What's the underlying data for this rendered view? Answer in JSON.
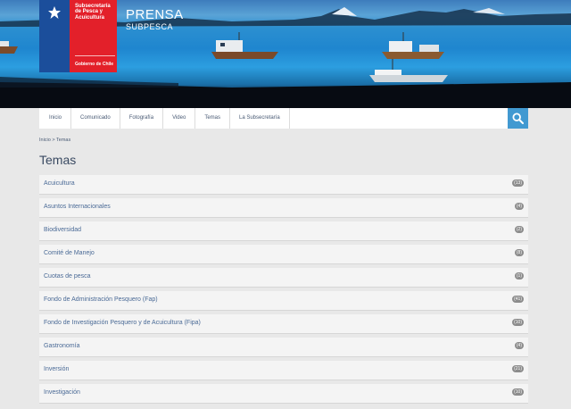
{
  "header": {
    "crest_text": "Subsecretaría de Pesca y Acuicultura",
    "crest_gov": "Gobierno de Chile",
    "site_title": "PRENSA",
    "site_subtitle": "SUBPESCA"
  },
  "nav": {
    "items": [
      "Inicio",
      "Comunicado",
      "Fotografía",
      "Video",
      "Temas",
      "La Subsecretaría"
    ],
    "search_icon": "search-icon"
  },
  "breadcrumb": "Inicio > Temas",
  "page_title": "Temas",
  "topics": [
    {
      "label": "Acuicultura",
      "count": "(13)"
    },
    {
      "label": "Asuntos Internacionales",
      "count": "(4)"
    },
    {
      "label": "Biodiversidad",
      "count": "(2)"
    },
    {
      "label": "Comité de Manejo",
      "count": "(8)"
    },
    {
      "label": "Cuotas de pesca",
      "count": "(1)"
    },
    {
      "label": "Fondo de Administración Pesquero (Fap)",
      "count": "(41)"
    },
    {
      "label": "Fondo de Investigación Pesquero y de Acuicultura (Fipa)",
      "count": "(10)"
    },
    {
      "label": "Gastronomía",
      "count": "(4)"
    },
    {
      "label": "Inversión",
      "count": "(21)"
    },
    {
      "label": "Investigación",
      "count": "(10)"
    }
  ],
  "colors": {
    "nav_accent": "#4199d1",
    "crest_blue": "#1b4e9b",
    "crest_red": "#e3202a"
  }
}
